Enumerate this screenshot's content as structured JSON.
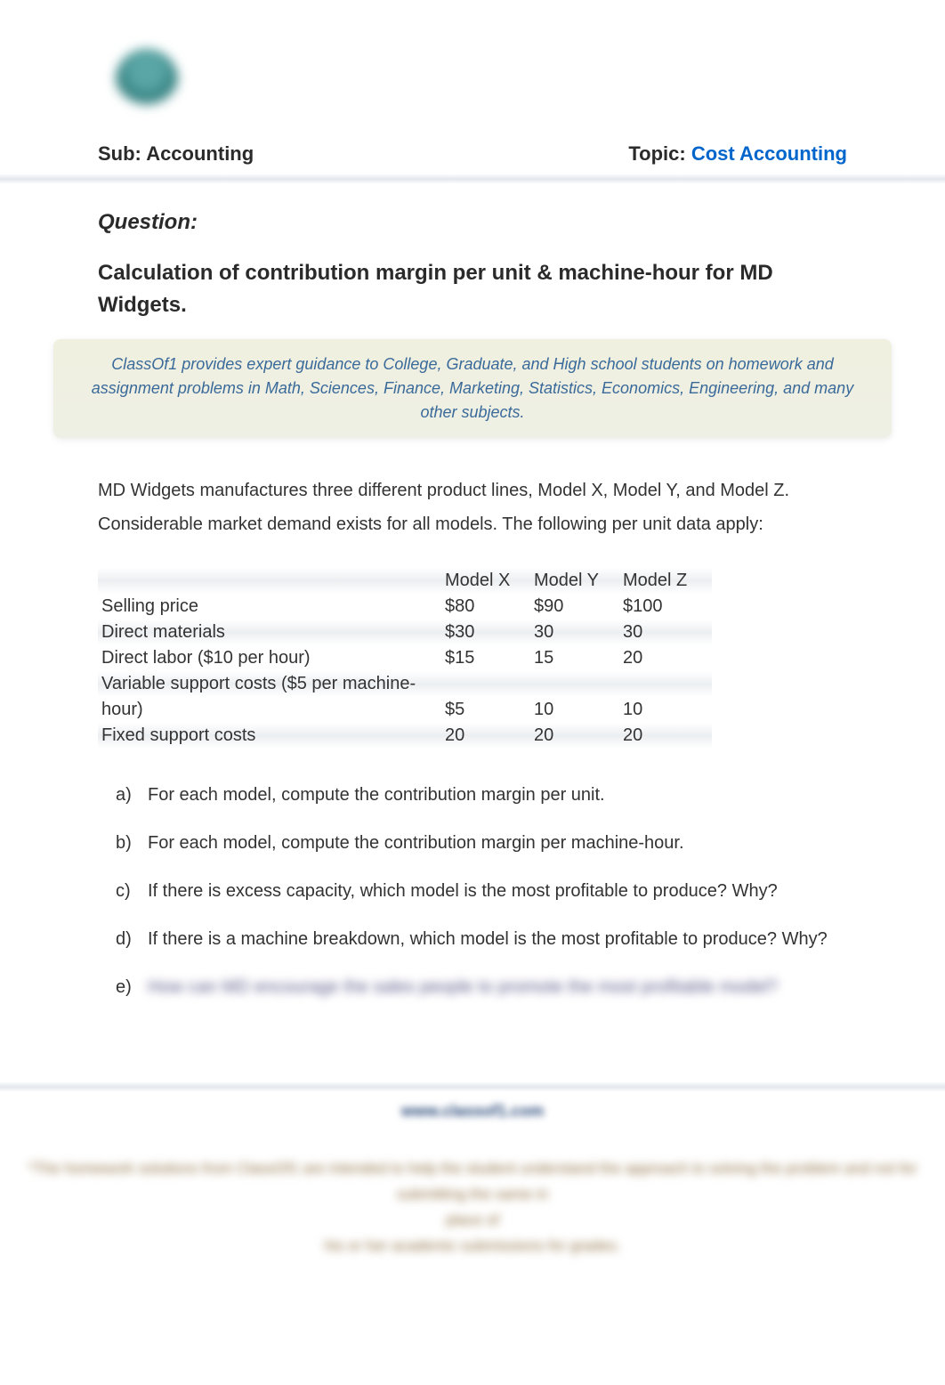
{
  "header": {
    "sub_label": "Sub: ",
    "sub_value": "Accounting",
    "topic_label": "Topic: ",
    "topic_value": "Cost Accounting"
  },
  "question_label": "Question:",
  "title": "Calculation of contribution margin per unit & machine-hour for MD Widgets.",
  "promo": "ClassOf1 provides expert guidance to College, Graduate, and High school students on homework and assignment problems in Math, Sciences, Finance, Marketing, Statistics, Economics, Engineering, and many other subjects.",
  "intro": "MD Widgets manufactures three different product lines, Model X, Model Y, and Model Z. Considerable market demand exists for all models. The following per unit data apply:",
  "table": {
    "cols": [
      "Model X",
      "Model Y",
      "Model Z"
    ],
    "rows": [
      {
        "label": "Selling price",
        "values": [
          "$80",
          "$90",
          "$100"
        ]
      },
      {
        "label": "Direct materials",
        "values": [
          "$30",
          "30",
          "30"
        ]
      },
      {
        "label": "Direct labor ($10 per hour)",
        "values": [
          "$15",
          "15",
          "20"
        ]
      },
      {
        "label": "Variable support costs ($5 per machine-hour)",
        "values": [
          "$5",
          "10",
          "10"
        ]
      },
      {
        "label": "Fixed support costs",
        "values": [
          "20",
          "20",
          "20"
        ]
      }
    ]
  },
  "questions": [
    {
      "marker": "a)",
      "text": "For each model, compute the contribution margin per unit."
    },
    {
      "marker": "b)",
      "text": "For each model, compute the contribution margin per machine-hour."
    },
    {
      "marker": "c)",
      "text": "If there is excess capacity, which model is the most profitable to produce? Why?"
    },
    {
      "marker": "d)",
      "text": "If there is a machine breakdown, which model is the most profitable to produce? Why?"
    },
    {
      "marker": "e)",
      "text": "How can MD encourage the sales people to promote the most profitable model?",
      "blurred": true
    }
  ],
  "footer": {
    "url": "www.classof1.com",
    "disclaimer_line1": "*The homework solutions from ClassOf1 are intended to help the student understand the approach to solving the problem and not for submitting the same in",
    "disclaimer_line2": "place of",
    "disclaimer_line3": "his or her academic submissions for grades."
  }
}
